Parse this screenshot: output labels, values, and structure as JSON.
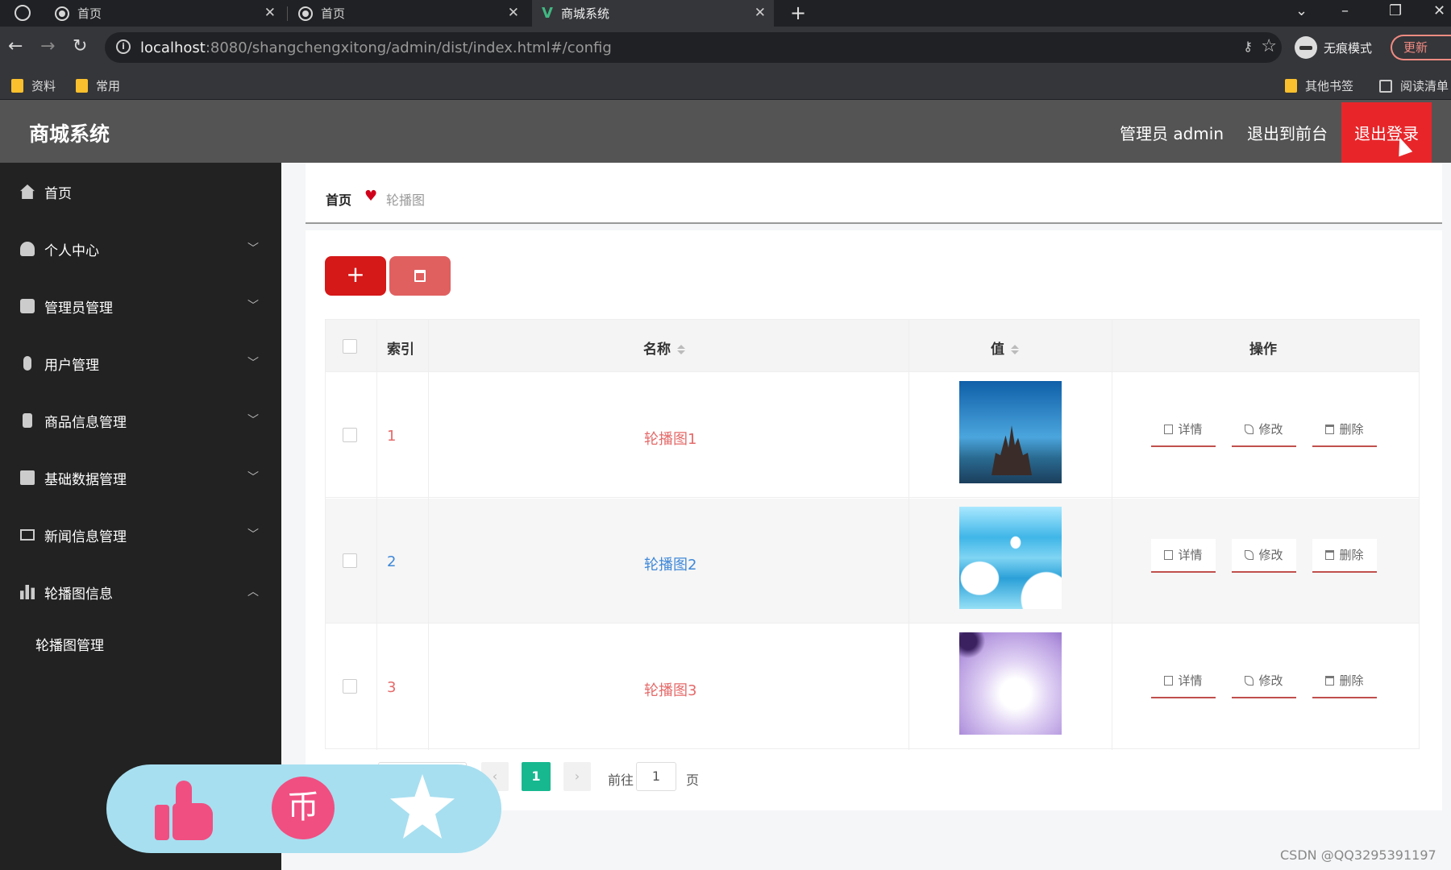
{
  "browser": {
    "tabs": [
      {
        "title": "首页"
      },
      {
        "title": "首页"
      },
      {
        "title": "商城系统"
      }
    ],
    "url_host": "localhost",
    "url_path": ":8080/shangchengxitong/admin/dist/index.html#/config",
    "incognito_label": "无痕模式",
    "update_label": "更新",
    "bookmarks": [
      "资料",
      "常用"
    ],
    "bookmarks_right": [
      "其他书签",
      "阅读清单"
    ]
  },
  "header": {
    "brand": "商城系统",
    "admin_label": "管理员 admin",
    "front_label": "退出到前台",
    "logout_label": "退出登录"
  },
  "sidebar": {
    "items": [
      {
        "label": "首页",
        "icon": "home-icon"
      },
      {
        "label": "个人中心",
        "icon": "user-icon"
      },
      {
        "label": "管理员管理",
        "icon": "chat-icon"
      },
      {
        "label": "用户管理",
        "icon": "mic-icon"
      },
      {
        "label": "商品信息管理",
        "icon": "phone-icon"
      },
      {
        "label": "基础数据管理",
        "icon": "clipboard-icon"
      },
      {
        "label": "新闻信息管理",
        "icon": "mail-icon"
      },
      {
        "label": "轮播图信息",
        "icon": "bar-chart-icon"
      }
    ],
    "submenu_item": "轮播图管理"
  },
  "breadcrumb": {
    "home": "首页",
    "current": "轮播图"
  },
  "toolbar": {
    "add_label": "+"
  },
  "table": {
    "headers": {
      "index": "索引",
      "name": "名称",
      "value": "值",
      "action": "操作"
    },
    "rows": [
      {
        "index": "1",
        "name": "轮播图1"
      },
      {
        "index": "2",
        "name": "轮播图2"
      },
      {
        "index": "3",
        "name": "轮播图3"
      }
    ],
    "actions": {
      "detail": "详情",
      "edit": "修改",
      "delete": "删除"
    }
  },
  "pagination": {
    "current": "1",
    "goto_label": "前往",
    "goto_value": "1",
    "page_suffix": "页"
  },
  "overlay": {
    "coin_glyph": "币"
  },
  "watermark": "CSDN @QQ3295391197",
  "colors": {
    "accent_red": "#d51818",
    "logout_red": "#e8262a",
    "pager_active": "#17b890",
    "sidebar_bg": "#222222",
    "header_bg": "#545454"
  }
}
